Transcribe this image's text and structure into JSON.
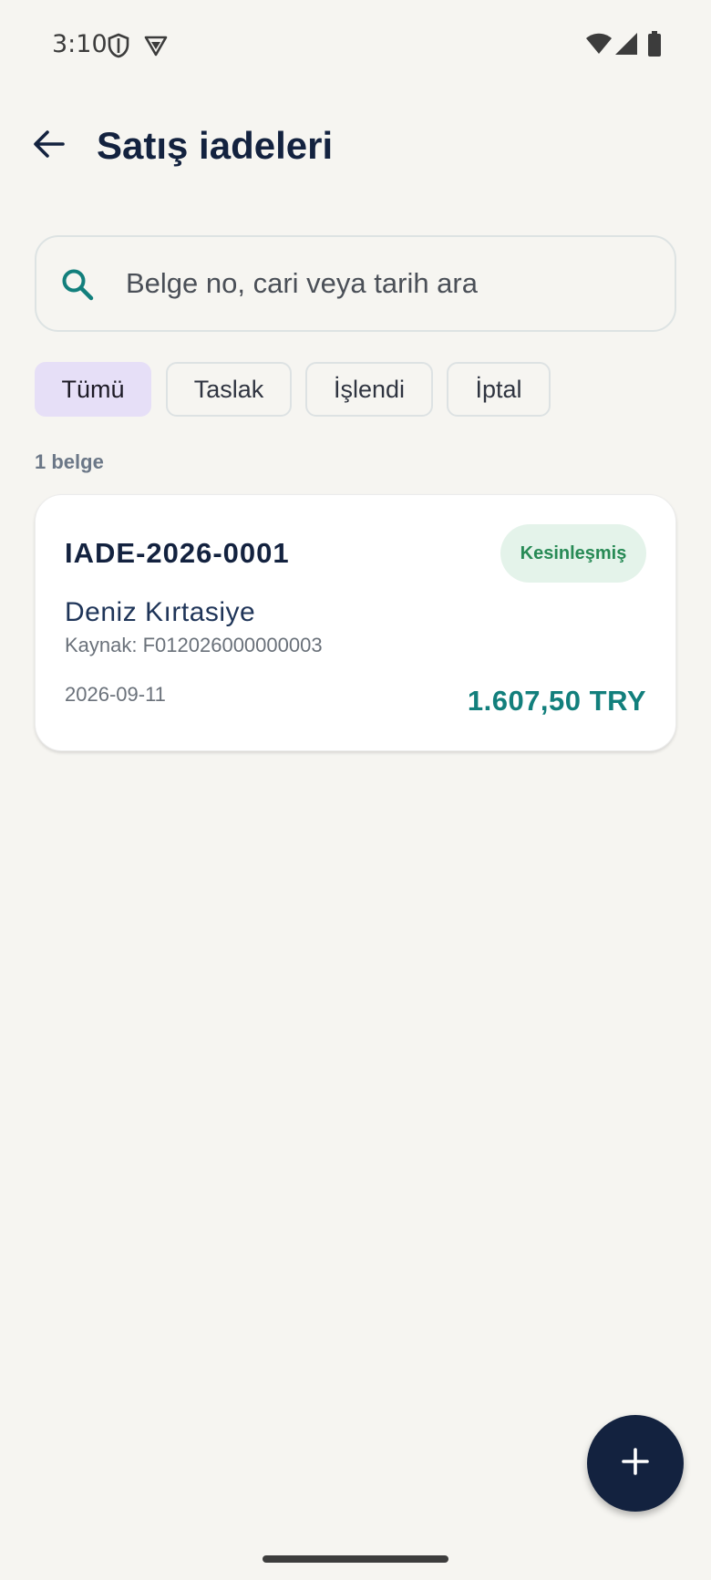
{
  "status_bar": {
    "time": "3:10",
    "icons": [
      "shield-icon",
      "vpn-icon",
      "wifi-icon",
      "signal-icon",
      "battery-icon"
    ]
  },
  "app_bar": {
    "title": "Satış iadeleri",
    "back_icon": "arrow-left-icon"
  },
  "search": {
    "placeholder": "Belge no, cari veya tarih ara",
    "value": "",
    "icon": "search-icon"
  },
  "filters": {
    "chips": [
      {
        "label": "Tümü",
        "active": true
      },
      {
        "label": "Taslak",
        "active": false
      },
      {
        "label": "İşlendi",
        "active": false
      },
      {
        "label": "İptal",
        "active": false
      }
    ]
  },
  "list": {
    "count_label": "1 belge",
    "items": [
      {
        "doc_no": "IADE-2026-0001",
        "status": "Kesinleşmiş",
        "customer": "Deniz Kırtasiye",
        "source": "Kaynak: F012026000000003",
        "date": "2026-09-11",
        "amount": "1.607,50 TRY"
      }
    ]
  },
  "fab": {
    "icon": "plus-icon"
  },
  "colors": {
    "primary": "#13223f",
    "accent": "#127f7c",
    "status_confirmed": "#278a55",
    "chip_active": "#e6dff7",
    "background": "#f6f5f1"
  }
}
